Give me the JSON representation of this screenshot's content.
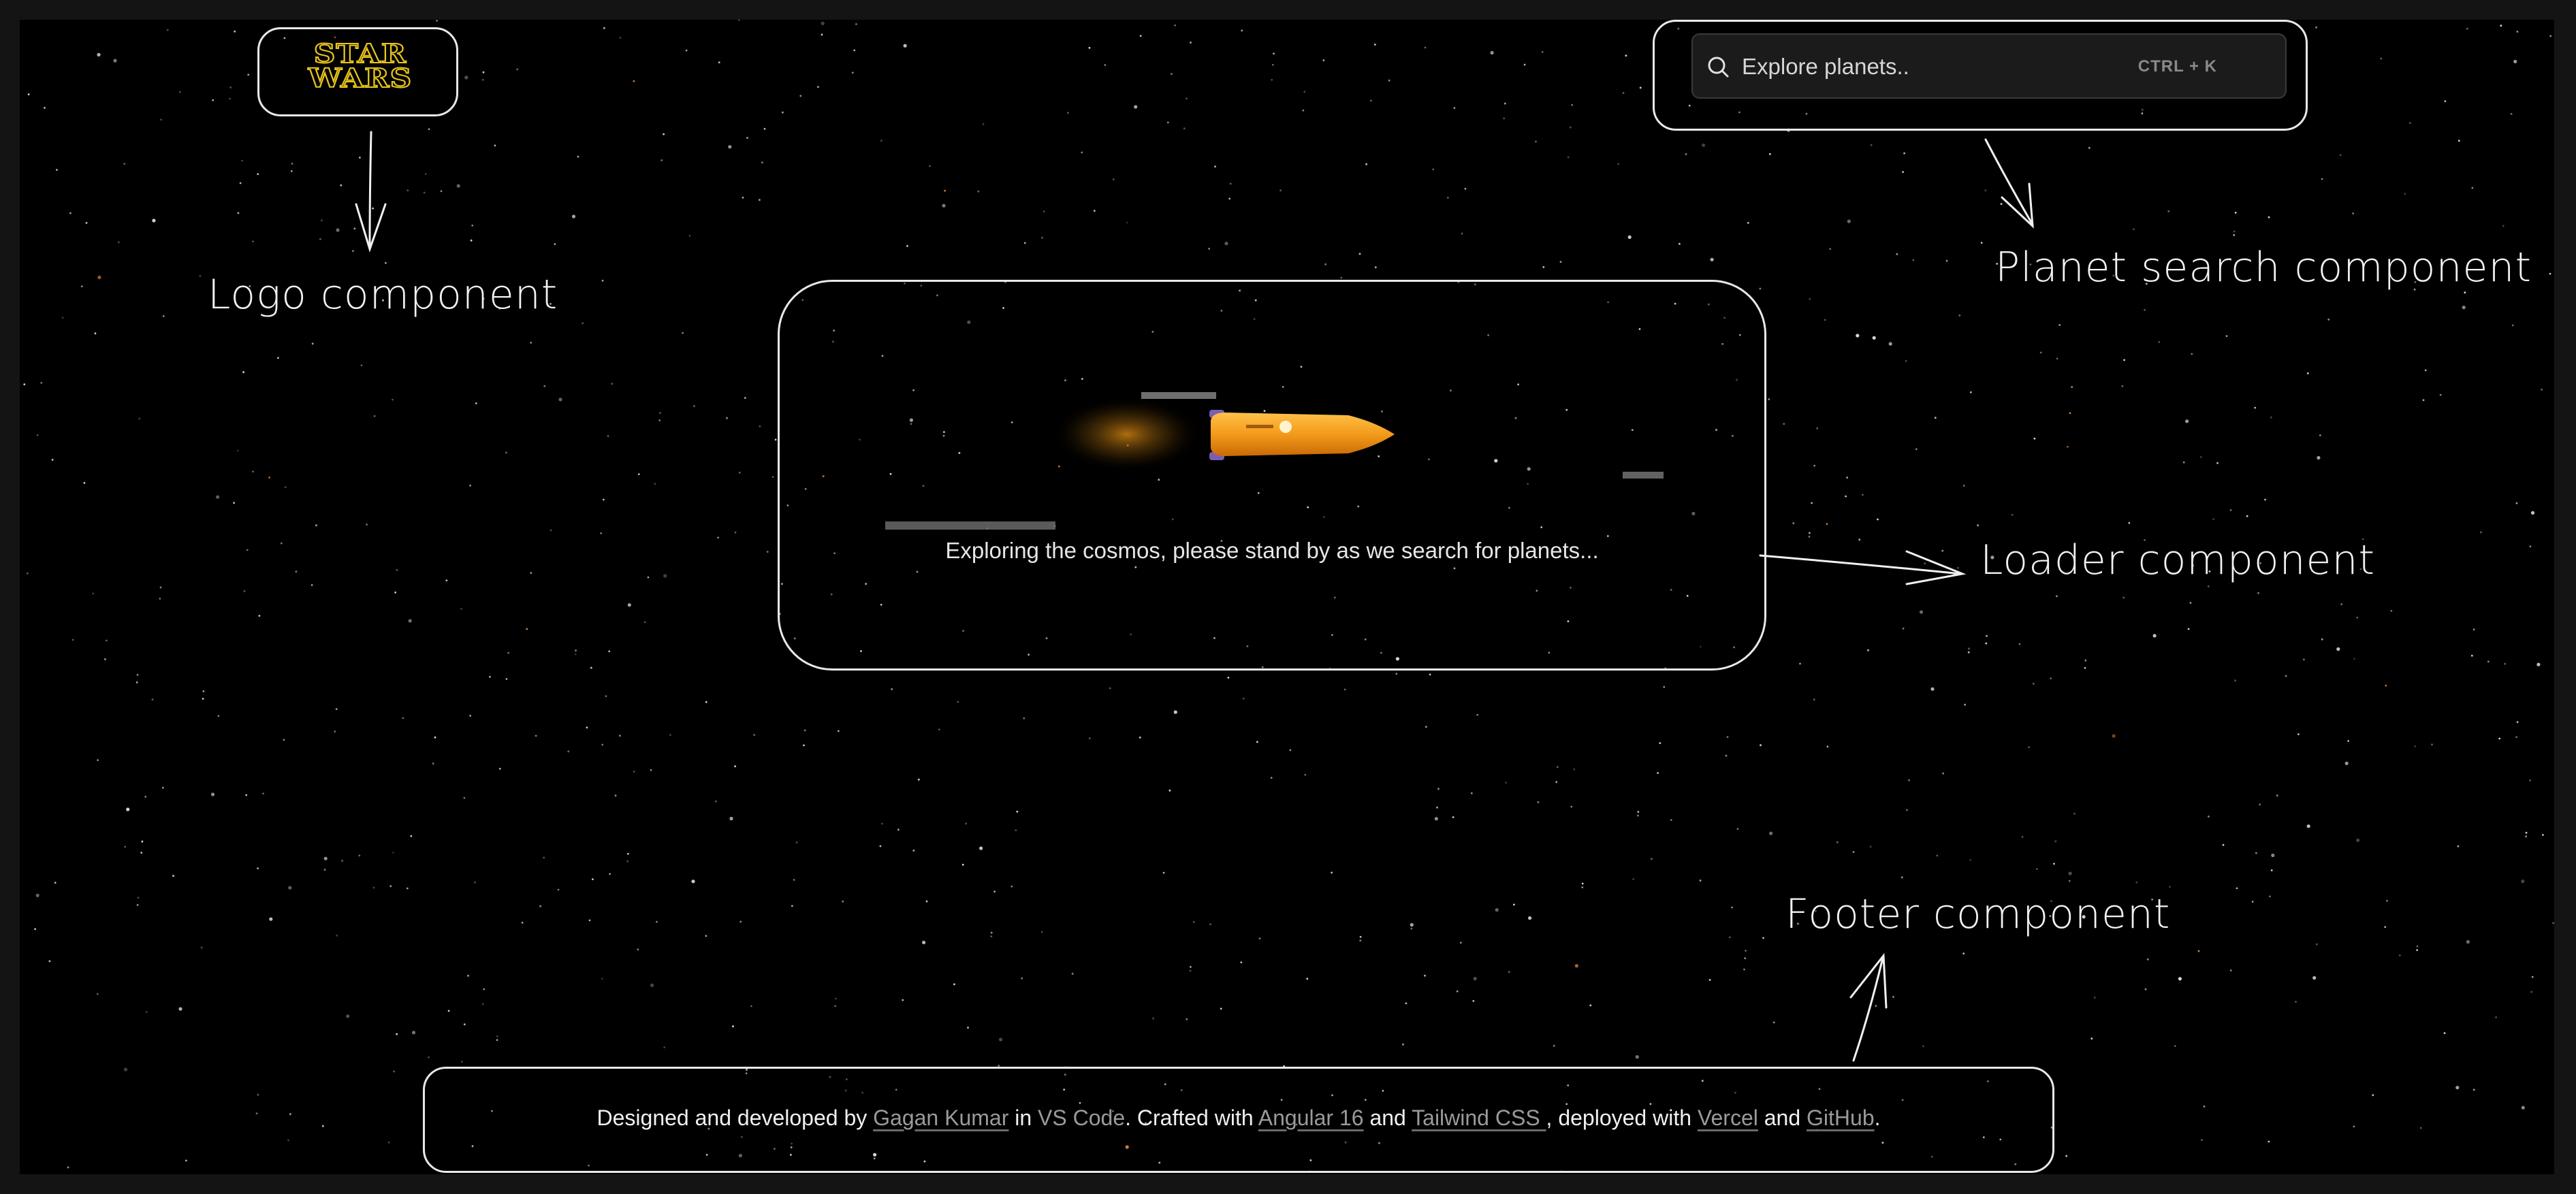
{
  "logo": {
    "line1": "STAR",
    "line2": "WARS",
    "annotation": "Logo component"
  },
  "search": {
    "placeholder": "Explore planets..",
    "shortcut": "CTRL + K",
    "annotation": "Planet search component"
  },
  "loader": {
    "message": "Exploring the cosmos, please stand by as we search for planets...",
    "annotation": "Loader component"
  },
  "footer": {
    "t1": "Designed and developed by ",
    "author": "Gagan Kumar",
    "t2": " in ",
    "editor": "VS Code",
    "t3": ". Crafted with ",
    "framework": "Angular 16",
    "t4": " and ",
    "css": "Tailwind CSS ",
    "t5": ", deployed with ",
    "host": "Vercel",
    "t6": " and ",
    "repo": "GitHub",
    "t7": ".",
    "annotation": "Footer component"
  },
  "colors": {
    "background": "#000000",
    "frame": "#e8e8e8",
    "logo": "#e8c51a",
    "rocket": "#f39a1a"
  }
}
